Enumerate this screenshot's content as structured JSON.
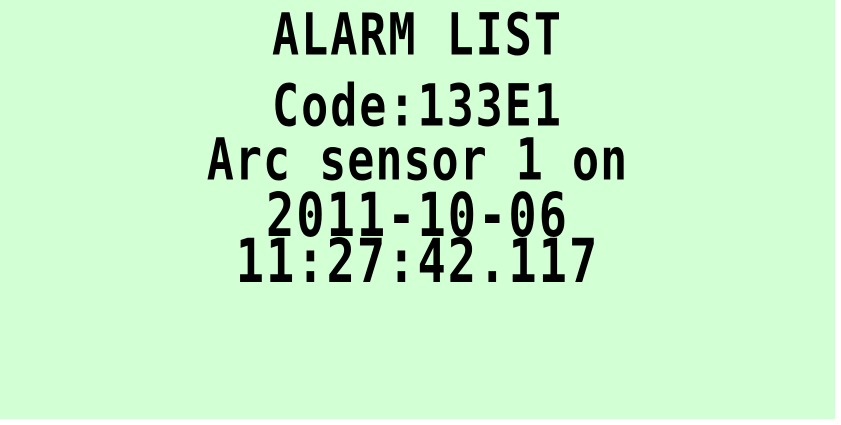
{
  "screen": {
    "title": "ALARM LIST",
    "code_line": "Code:133E1",
    "description": "Arc sensor 1 on",
    "date": "2011-10-06",
    "time": "11:27:42.117"
  },
  "colors": {
    "lcd_background": "#d3ffd5",
    "text": "#000000"
  }
}
